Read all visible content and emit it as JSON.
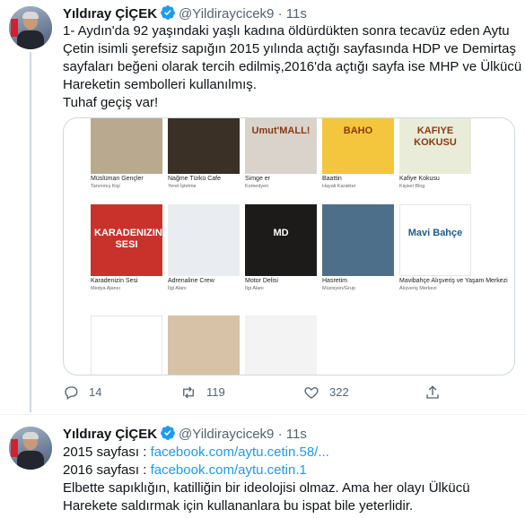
{
  "tweet1": {
    "name": "Yıldıray ÇİÇEK",
    "handle": "@Yildiraycicek9",
    "dot": "·",
    "time": "11s",
    "lines": [
      "1- Aydın'da 92 yaşındaki yaşlı kadına öldürdükten sonra tecavüz eden Aytu",
      "Çetin isimli şerefsiz sapığın 2015 yılında açtığı sayfasında HDP ve Demirtaş",
      "sayfaları beğeni olarak tercih edilmiş,2016'da açtığı sayfa ise MHP ve Ülkücü",
      "Hareketin sembolleri kullanılmış.",
      "Tuhaf geçiş var!"
    ],
    "media_cards": [
      {
        "name": "Müslüman Gençler",
        "category": "Tanınmış Kişi",
        "img_text": "",
        "color": "#b9a98f"
      },
      {
        "name": "Nağme Türkü Cafe",
        "category": "Yerel İşletme",
        "img_text": "",
        "color": "#3a3026"
      },
      {
        "name": "Simge er",
        "category": "Komedyen",
        "img_text": "Umut'MALL!",
        "color": "#d9d3cc"
      },
      {
        "name": "Baattin",
        "category": "Hayali Karakter",
        "img_text": "BAHO",
        "color": "#f4c63d"
      },
      {
        "name": "Kafiye Kokusu",
        "category": "Kişisel Blog",
        "img_text": "KAFIYE KOKUSU",
        "color": "#e8ecd9"
      },
      {
        "name": "Karadenizin Sesi",
        "category": "Medya Ajansı",
        "img_text": "KARADENIZIN SESI",
        "color": "#c8322b"
      },
      {
        "name": "Adrenaline Crew",
        "category": "İlgi Alanı",
        "img_text": "",
        "color": "#e9edf1"
      },
      {
        "name": "Motor Delisi",
        "category": "İlgi Alanı",
        "img_text": "MD",
        "color": "#1d1b1a"
      },
      {
        "name": "Hasretim",
        "category": "Müzisyen/Grup",
        "img_text": "",
        "color": "#4d6f8a"
      },
      {
        "name": "Mavibahçe Alışveriş ve Yaşam Merkezi",
        "category": "Alışveriş Merkezi",
        "img_text": "Mavi Bahçe",
        "color": "#ffffff"
      },
      {
        "name": "",
        "category": "",
        "img_text": "",
        "color": "#ffffff"
      },
      {
        "name": "",
        "category": "",
        "img_text": "",
        "color": "#d7c2a8"
      },
      {
        "name": "",
        "category": "",
        "img_text": "",
        "color": "#f3f3f3"
      }
    ],
    "actions": {
      "replies": "14",
      "retweets": "119",
      "likes": "322"
    }
  },
  "tweet2": {
    "name": "Yıldıray ÇİÇEK",
    "handle": "@Yildiraycicek9",
    "dot": "·",
    "time": "11s",
    "line1_prefix": "2015 sayfası : ",
    "line1_link": "facebook.com/aytu.cetin.58/...",
    "line2_prefix": "2016 sayfası : ",
    "line2_link": "facebook.com/aytu.cetin.1",
    "line3": "Elbette sapıklığın, katilliğin bir ideolojisi olmaz. Ama her olayı Ülkücü",
    "line4": "Harekete saldırmak için kullananlara bu ispat bile yeterlidir."
  },
  "colors": {
    "accent": "#1d9bf0",
    "text": "#0f1419",
    "muted": "#536471"
  }
}
